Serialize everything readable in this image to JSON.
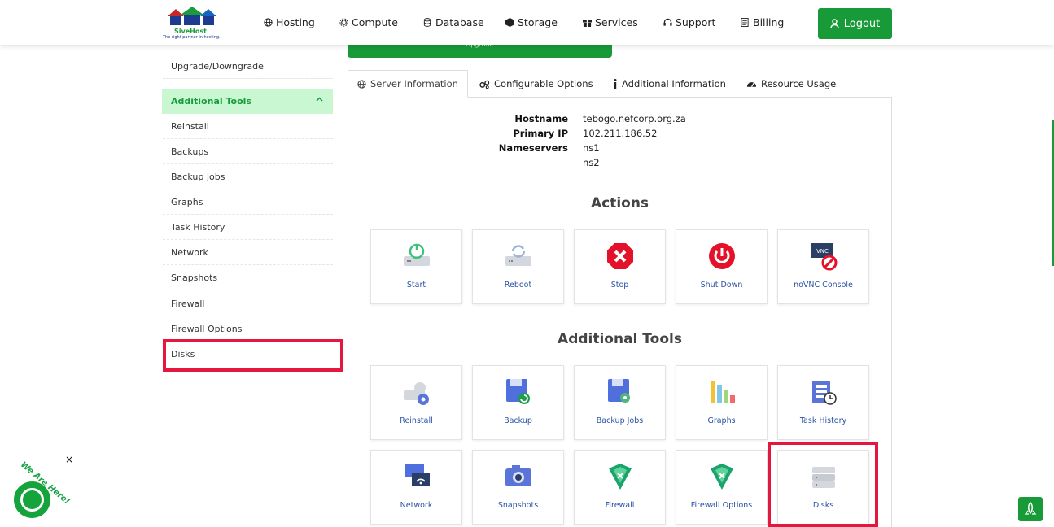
{
  "brand": {
    "name": "SiveHost",
    "tagline": "The right partner in hosting."
  },
  "nav": [
    {
      "label": "Hosting",
      "icon": "globe-icon"
    },
    {
      "label": "Compute",
      "icon": "gear-icon"
    },
    {
      "label": "Database",
      "icon": "database-icon"
    },
    {
      "label": "Storage",
      "icon": "box-icon"
    },
    {
      "label": "Services",
      "icon": "gift-icon"
    },
    {
      "label": "Support",
      "icon": "headset-icon"
    },
    {
      "label": "Billing",
      "icon": "invoice-icon"
    }
  ],
  "logout_label": "Logout",
  "sidebar": {
    "partial_top": "",
    "upgrade": "Upgrade/Downgrade",
    "tools_header": "Additional Tools",
    "items": [
      "Reinstall",
      "Backups",
      "Backup Jobs",
      "Graphs",
      "Task History",
      "Network",
      "Snapshots",
      "Firewall",
      "Firewall Options",
      "Disks"
    ]
  },
  "upgrade_button": "Upgrade",
  "tabs": [
    {
      "label": "Server Information",
      "icon": "globe-icon"
    },
    {
      "label": "Configurable Options",
      "icon": "cogs-icon"
    },
    {
      "label": "Additional Information",
      "icon": "info-icon"
    },
    {
      "label": "Resource Usage",
      "icon": "gauge-icon"
    }
  ],
  "server": {
    "hostname_label": "Hostname",
    "hostname": "tebogo.nefcorp.org.za",
    "ip_label": "Primary IP",
    "ip": "102.211.186.52",
    "ns_label": "Nameservers",
    "ns1": "ns1",
    "ns2": "ns2"
  },
  "actions_title": "Actions",
  "actions": [
    "Start",
    "Reboot",
    "Stop",
    "Shut Down",
    "noVNC Console"
  ],
  "tools_title": "Additional Tools",
  "tools": [
    "Reinstall",
    "Backup",
    "Backup Jobs",
    "Graphs",
    "Task History",
    "Network",
    "Snapshots",
    "Firewall",
    "Firewall Options",
    "Disks"
  ],
  "chat": {
    "text": "We Are Here!",
    "close": "×"
  },
  "colors": {
    "brand_green": "#179a37",
    "highlight_red": "#e4173e",
    "link_blue": "#2a52a6"
  }
}
